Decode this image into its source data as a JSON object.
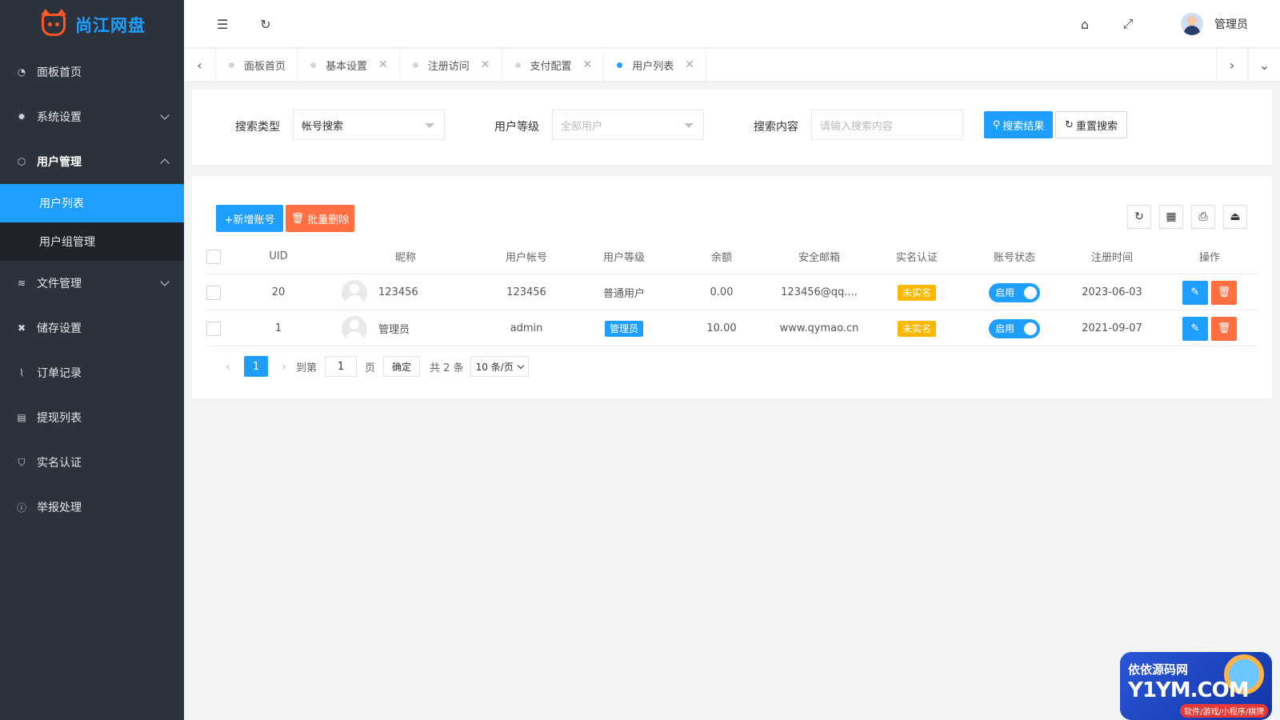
{
  "app": {
    "title": "尚江网盘"
  },
  "sidebar": {
    "items": [
      {
        "label": "面板首页",
        "icon": "dashboard-icon"
      },
      {
        "label": "系统设置",
        "icon": "gear-icon"
      },
      {
        "label": "用户管理",
        "icon": "cube-icon"
      },
      {
        "label": "文件管理",
        "icon": "layers-icon"
      },
      {
        "label": "储存设置",
        "icon": "tools-icon"
      },
      {
        "label": "订单记录",
        "icon": "pulse-icon"
      },
      {
        "label": "提现列表",
        "icon": "clipboard-icon"
      },
      {
        "label": "实名认证",
        "icon": "shield-check-icon"
      },
      {
        "label": "举报处理",
        "icon": "info-icon"
      }
    ],
    "sub_items": [
      {
        "label": "用户列表",
        "active": true
      },
      {
        "label": "用户组管理",
        "active": false
      }
    ]
  },
  "header": {
    "user_name": "管理员"
  },
  "tabs": [
    {
      "label": "面板首页",
      "closable": false
    },
    {
      "label": "基本设置",
      "closable": true
    },
    {
      "label": "注册访问",
      "closable": true
    },
    {
      "label": "支付配置",
      "closable": true
    },
    {
      "label": "用户列表",
      "closable": true,
      "active": true
    }
  ],
  "search": {
    "type_label": "搜索类型",
    "type_value": "帐号搜索",
    "level_label": "用户等级",
    "level_placeholder": "全部用户",
    "content_label": "搜索内容",
    "content_placeholder": "请输入搜索内容",
    "search_button": "搜索结果",
    "reset_button": "重置搜索"
  },
  "toolbar": {
    "add_button": "+新增账号",
    "batch_delete_button": "批量删除"
  },
  "table": {
    "headers": [
      "UID",
      "昵称",
      "用户帐号",
      "用户等级",
      "余额",
      "安全邮箱",
      "实名认证",
      "账号状态",
      "注册时间",
      "操作"
    ],
    "rows": [
      {
        "uid": "20",
        "nickname": "123456",
        "account": "123456",
        "level": "普通用户",
        "level_badge": false,
        "balance": "0.00",
        "email": "123456@qq....",
        "realname": "未实名",
        "status": "启用",
        "reg_time": "2023-06-03"
      },
      {
        "uid": "1",
        "nickname": "管理员",
        "account": "admin",
        "level": "管理员",
        "level_badge": true,
        "balance": "10.00",
        "email": "www.qymao.cn",
        "realname": "未实名",
        "status": "启用",
        "reg_time": "2021-09-07"
      }
    ]
  },
  "pagination": {
    "current_page": "1",
    "goto_label": "到第",
    "goto_value": "1",
    "page_suffix": "页",
    "confirm_button": "确定",
    "total_text": "共 2 条",
    "page_size": "10 条/页"
  },
  "watermark": {
    "line1": "依依源码网",
    "line2": "Y1YM.COM",
    "line3": "软件/游戏/小程序/棋牌"
  },
  "colors": {
    "sidebar_bg": "#2b323b",
    "accent": "#1e9fff",
    "danger": "#ff5722",
    "warning": "#ffb800"
  }
}
